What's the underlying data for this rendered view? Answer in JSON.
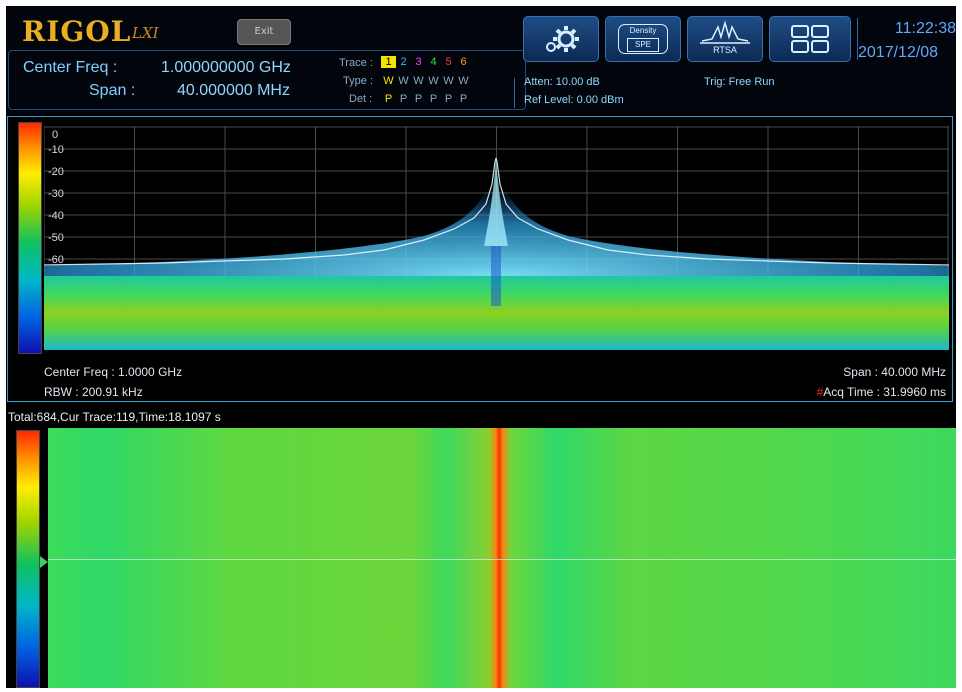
{
  "brand": {
    "name": "RIGOL",
    "suffix": "LXI"
  },
  "header": {
    "exit_label": "Exit",
    "center_freq_label": "Center Freq :",
    "center_freq_value": "1.000000000 GHz",
    "span_label": "Span :",
    "span_value": "40.000000 MHz",
    "trace_label": "Trace :",
    "type_label": "Type :",
    "det_label": "Det :",
    "traces": [
      "1",
      "2",
      "3",
      "4",
      "5",
      "6"
    ],
    "trace_colors": [
      "#f2e600",
      "#2fb8ff",
      "#ff3cff",
      "#2ee05a",
      "#ff3a3a",
      "#ffa000"
    ],
    "types": [
      "W",
      "W",
      "W",
      "W",
      "W",
      "W"
    ],
    "dets": [
      "P",
      "P",
      "P",
      "P",
      "P",
      "P"
    ],
    "atten": "Atten: 10.00 dB",
    "ref_level": "Ref Level: 0.00 dBm",
    "trig": "Trig: Free Run",
    "time": "11:22:38",
    "date": "2017/12/08"
  },
  "toolbar": {
    "settings_icon": "gear-icon",
    "density_label_1": "Density",
    "density_label_2": "SPE",
    "rtsa_label": "RTSA",
    "layout_icon": "grid-icon"
  },
  "spectrum": {
    "y_ticks": [
      "0",
      "-10",
      "-20",
      "-30",
      "-40",
      "-50",
      "-60"
    ],
    "center_freq": "Center Freq : 1.0000 GHz",
    "rbw": "RBW : 200.91 kHz",
    "span": "Span : 40.000 MHz",
    "acq_time": "Acq Time : 31.9960 ms"
  },
  "waterfall": {
    "status": "Total:684,Cur Trace:119,Time:18.1097 s"
  },
  "colors": {
    "accent": "#3aa0d8",
    "header_text": "#8fd8ff",
    "logo": "#e8b021"
  }
}
